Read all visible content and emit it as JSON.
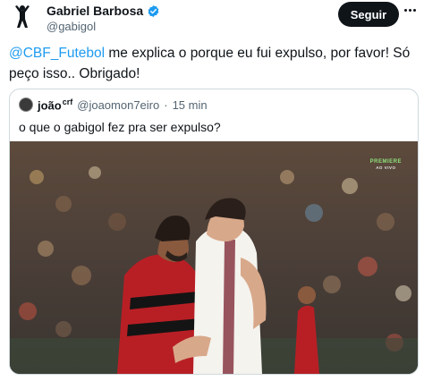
{
  "author": {
    "name": "Gabriel Barbosa",
    "handle": "@gabigol",
    "verified": true,
    "avatar_icon": "player-silhouette-icon",
    "verified_icon": "verified-badge-icon",
    "verified_color": "#1d9bf0"
  },
  "follow_button": {
    "label": "Seguir"
  },
  "more_icon": "ellipsis-icon",
  "tweet": {
    "mention": "@CBF_Futebol",
    "text": " me explica o porque eu fui expulso, por favor! Só peço isso.. Obrigado!"
  },
  "quote": {
    "name": "joão",
    "flag": "crf",
    "handle": "@joaomon7eiro",
    "separator": "·",
    "time": "15 min",
    "text": "o que o gabigol fez pra ser expulso?"
  },
  "media": {
    "broadcaster": "PREMIERE",
    "live_label": "AO VIVO"
  },
  "colors": {
    "accent": "#1d9bf0",
    "text": "#0f1419",
    "muted": "#536471",
    "border": "#cfd9de"
  }
}
